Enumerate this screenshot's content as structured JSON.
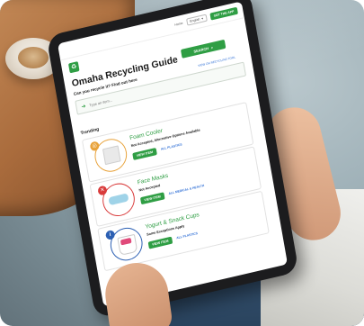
{
  "header": {
    "home_label": "Home",
    "language_label": "English",
    "cta_label": "GET THE APP"
  },
  "title": "Omaha Recycling Guide",
  "search": {
    "button_label": "SEARCH",
    "placeholder": "Type an item...",
    "subtitle": "Can you recycle it? Find out here",
    "map_link": "VIEW ON RECYCLING TOOL"
  },
  "trending_label": "Trending",
  "items": [
    {
      "name": "Foam Cooler",
      "status": "Not Accepted, Alternative Options Available",
      "view_label": "VIEW ITEM",
      "category": "ALL PLASTICS",
      "icon": "info-alternative-icon",
      "accent": "#e8a23a"
    },
    {
      "name": "Face Masks",
      "status": "Not Accepted",
      "view_label": "VIEW ITEM",
      "category": "ALL MEDICAL & HEALTH",
      "icon": "x-not-accepted-icon",
      "accent": "#d93b3b"
    },
    {
      "name": "Yogurt & Snack Cups",
      "status": "Some Exceptions Apply",
      "view_label": "VIEW ITEM",
      "category": "ALL PLASTICS",
      "icon": "info-exceptions-icon",
      "accent": "#2b5fb3"
    }
  ],
  "colors": {
    "brand_green": "#2f9e44",
    "link_blue": "#2f6fd6"
  }
}
